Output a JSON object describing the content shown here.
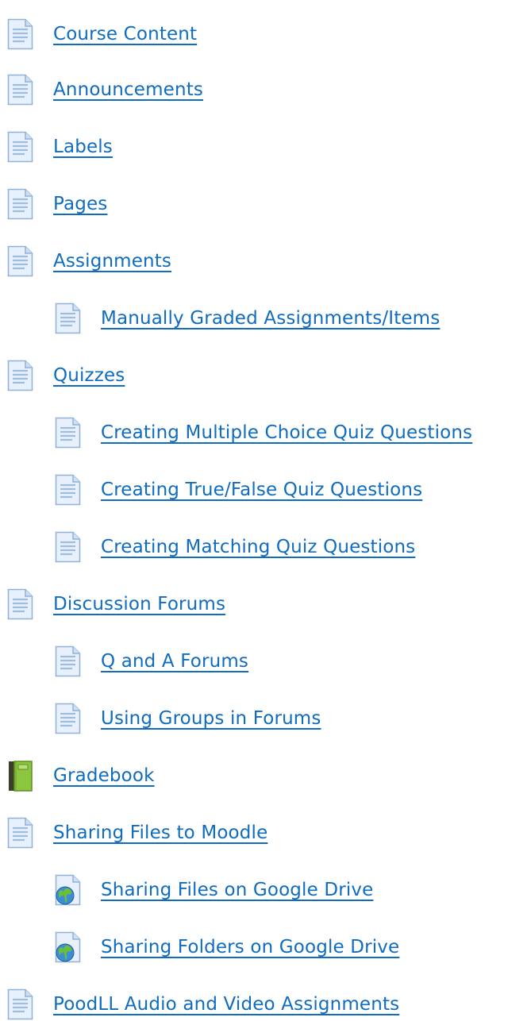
{
  "link_color": "#0f6cbf",
  "items": [
    {
      "label": "Course Content",
      "icon": "page-icon",
      "level": 0
    },
    {
      "label": "Announcements",
      "icon": "page-icon",
      "level": 0
    },
    {
      "label": "Labels",
      "icon": "page-icon",
      "level": 0
    },
    {
      "label": "Pages",
      "icon": "page-icon",
      "level": 0
    },
    {
      "label": "Assignments",
      "icon": "page-icon",
      "level": 0
    },
    {
      "label": "Manually Graded Assignments/Items",
      "icon": "page-icon",
      "level": 1
    },
    {
      "label": "Quizzes",
      "icon": "page-icon",
      "level": 0
    },
    {
      "label": "Creating Multiple Choice Quiz Questions",
      "icon": "page-icon",
      "level": 1
    },
    {
      "label": "Creating True/False Quiz Questions",
      "icon": "page-icon",
      "level": 1
    },
    {
      "label": "Creating Matching Quiz Questions",
      "icon": "page-icon",
      "level": 1
    },
    {
      "label": "Discussion Forums",
      "icon": "page-icon",
      "level": 0
    },
    {
      "label": "Q and A Forums",
      "icon": "page-icon",
      "level": 1
    },
    {
      "label": "Using Groups in Forums",
      "icon": "page-icon",
      "level": 1
    },
    {
      "label": "Gradebook",
      "icon": "book-icon",
      "level": 0
    },
    {
      "label": "Sharing Files to Moodle",
      "icon": "page-icon",
      "level": 0
    },
    {
      "label": "Sharing Files on Google Drive",
      "icon": "url-globe-icon",
      "level": 1
    },
    {
      "label": "Sharing Folders on Google Drive",
      "icon": "url-globe-icon",
      "level": 1
    },
    {
      "label": "PoodLL Audio and Video Assignments",
      "icon": "page-icon",
      "level": 0
    }
  ]
}
